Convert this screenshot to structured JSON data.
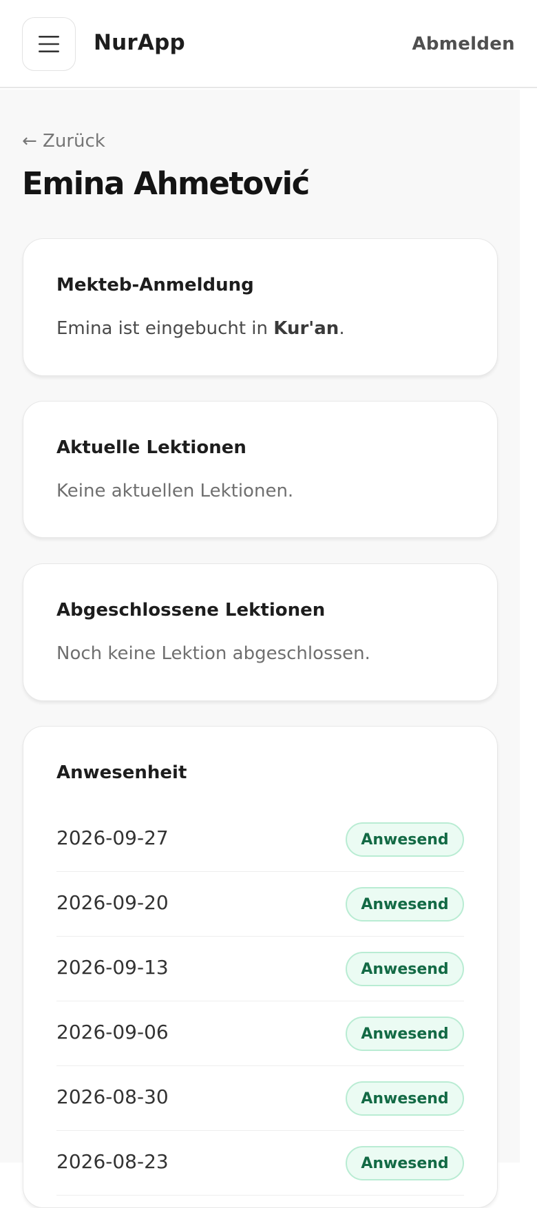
{
  "header": {
    "app_name": "NurApp",
    "logout_label": "Abmelden",
    "menu_icon": "hamburger-menu-icon"
  },
  "nav": {
    "back_label": "← Zurück"
  },
  "student": {
    "name": "Emina Ahmetović"
  },
  "enrollment": {
    "title": "Mekteb-Anmeldung",
    "text_prefix": "Emina ist eingebucht in ",
    "course": "Kur'an",
    "text_suffix": "."
  },
  "current_lessons": {
    "title": "Aktuelle Lektionen",
    "empty_text": "Keine aktuellen Lektionen."
  },
  "completed_lessons": {
    "title": "Abgeschlossene Lektionen",
    "empty_text": "Noch keine Lektion abgeschlossen."
  },
  "attendance": {
    "title": "Anwesenheit",
    "rows": [
      {
        "date": "2026-09-27",
        "status": "Anwesend"
      },
      {
        "date": "2026-09-20",
        "status": "Anwesend"
      },
      {
        "date": "2026-09-13",
        "status": "Anwesend"
      },
      {
        "date": "2026-09-06",
        "status": "Anwesend"
      },
      {
        "date": "2026-08-30",
        "status": "Anwesend"
      },
      {
        "date": "2026-08-23",
        "status": "Anwesend"
      }
    ]
  },
  "colors": {
    "badge_bg": "#ebfbf3",
    "badge_border": "#b9ecd3",
    "badge_text": "#136a45",
    "page_bg": "#f8f8f8"
  }
}
